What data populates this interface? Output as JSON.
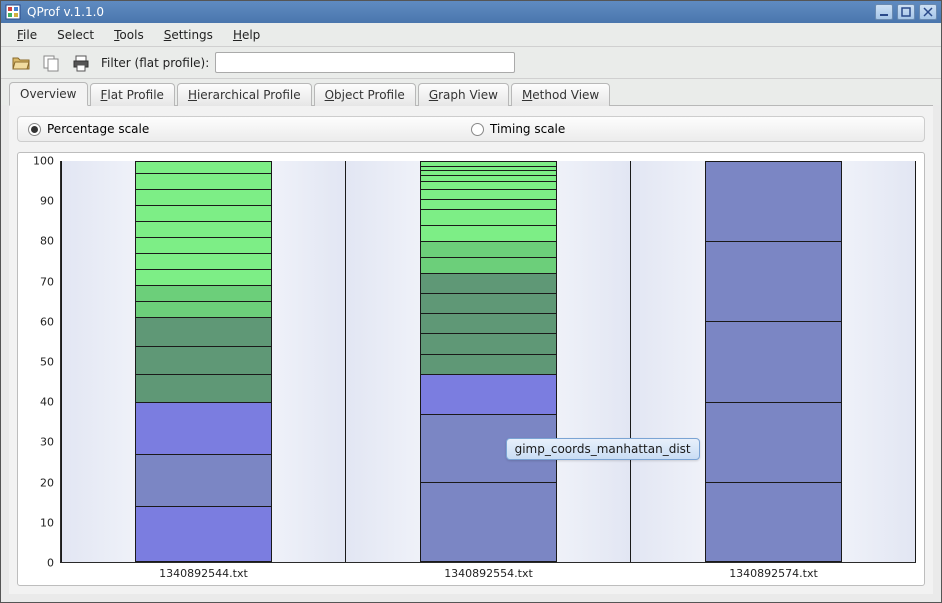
{
  "window": {
    "title": "QProf v.1.1.0"
  },
  "menubar": [
    {
      "label": "File",
      "ul": 0
    },
    {
      "label": "Select",
      "ul": -1
    },
    {
      "label": "Tools",
      "ul": 0
    },
    {
      "label": "Settings",
      "ul": 0
    },
    {
      "label": "Help",
      "ul": 0
    }
  ],
  "toolbar": {
    "filter_label": "Filter (flat profile):",
    "filter_value": ""
  },
  "tabs": [
    {
      "label": "Overview",
      "active": true
    },
    {
      "label": "Flat Profile",
      "ul": 0
    },
    {
      "label": "Hierarchical Profile",
      "ul": 0
    },
    {
      "label": "Object Profile",
      "ul": 0
    },
    {
      "label": "Graph View",
      "ul": 0
    },
    {
      "label": "Method View",
      "ul": 0
    }
  ],
  "scale": {
    "percentage_label": "Percentage scale",
    "timing_label": "Timing scale",
    "selected": "percentage"
  },
  "tooltip": {
    "text": "gimp_coords_manhattan_dist"
  },
  "chart_data": {
    "type": "bar",
    "ylabel": "",
    "ylim": [
      0,
      100
    ],
    "yticks": [
      0,
      10,
      20,
      30,
      40,
      50,
      60,
      70,
      80,
      90,
      100
    ],
    "categories": [
      "1340892544.txt",
      "1340892554.txt",
      "1340892574.txt"
    ],
    "colors": {
      "blue1": "#7b7de0",
      "blue2": "#7b86c4",
      "green1": "#5f9876",
      "green2": "#6ccf7a",
      "green3": "#7dee86"
    },
    "bars": [
      {
        "category": "1340892544.txt",
        "segments": [
          {
            "value": 14,
            "color": "blue1"
          },
          {
            "value": 13,
            "color": "blue2"
          },
          {
            "value": 13,
            "color": "blue1"
          },
          {
            "value": 7,
            "color": "green1"
          },
          {
            "value": 7,
            "color": "green1"
          },
          {
            "value": 7,
            "color": "green1"
          },
          {
            "value": 4,
            "color": "green2"
          },
          {
            "value": 4,
            "color": "green2"
          },
          {
            "value": 4,
            "color": "green3"
          },
          {
            "value": 4,
            "color": "green3"
          },
          {
            "value": 4,
            "color": "green3"
          },
          {
            "value": 4,
            "color": "green3"
          },
          {
            "value": 4,
            "color": "green3"
          },
          {
            "value": 4,
            "color": "green3"
          },
          {
            "value": 4,
            "color": "green3"
          },
          {
            "value": 3,
            "color": "green3"
          }
        ]
      },
      {
        "category": "1340892554.txt",
        "segments": [
          {
            "value": 20,
            "color": "blue2"
          },
          {
            "value": 17,
            "color": "blue2"
          },
          {
            "value": 10,
            "color": "blue1"
          },
          {
            "value": 5,
            "color": "green1"
          },
          {
            "value": 5,
            "color": "green1"
          },
          {
            "value": 5,
            "color": "green1"
          },
          {
            "value": 5,
            "color": "green1"
          },
          {
            "value": 5,
            "color": "green1"
          },
          {
            "value": 4,
            "color": "green2"
          },
          {
            "value": 4,
            "color": "green2"
          },
          {
            "value": 4,
            "color": "green3"
          },
          {
            "value": 4,
            "color": "green3"
          },
          {
            "value": 2.5,
            "color": "green3"
          },
          {
            "value": 2.5,
            "color": "green3"
          },
          {
            "value": 2,
            "color": "green3"
          },
          {
            "value": 1.5,
            "color": "green3"
          },
          {
            "value": 1.2,
            "color": "green3"
          },
          {
            "value": 1.2,
            "color": "green3"
          },
          {
            "value": 1.1,
            "color": "green3"
          }
        ]
      },
      {
        "category": "1340892574.txt",
        "segments": [
          {
            "value": 20,
            "color": "blue2"
          },
          {
            "value": 20,
            "color": "blue2"
          },
          {
            "value": 20,
            "color": "blue2"
          },
          {
            "value": 20,
            "color": "blue2"
          },
          {
            "value": 20,
            "color": "blue2"
          }
        ]
      }
    ]
  }
}
